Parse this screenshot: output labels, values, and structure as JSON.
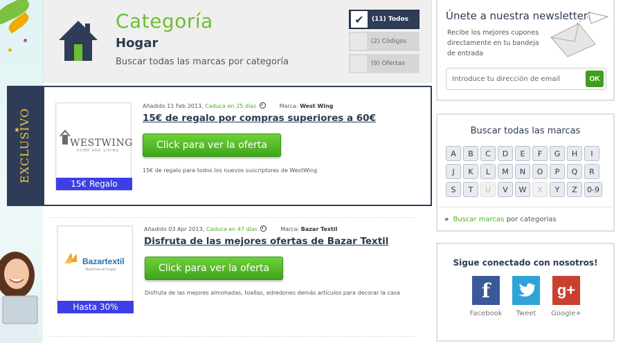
{
  "category": {
    "title": "Categoría",
    "name": "Hogar",
    "description": "Buscar todas las marcas por categoría"
  },
  "filters": [
    {
      "label": "(11) Todos",
      "selected": true
    },
    {
      "label": "(2) Códigos",
      "selected": false
    },
    {
      "label": "(9) Ofertas",
      "selected": false
    }
  ],
  "exclusive_label": "EXCLUSIVO",
  "offers": [
    {
      "added": "Añadido 11 Feb 2013,",
      "expires": "Caduca en 25 días",
      "brand_label": "Marca:",
      "brand": "West Wing",
      "title": "15€ de regalo por compras superiores a 60€",
      "cta": "Click para ver la oferta",
      "description": "15€ de regalo para todos los nuevos suscriptores de WestWing",
      "badge": "15€  Regalo",
      "logo_main": "WESTWING",
      "logo_sub": "HOME AND LIVING"
    },
    {
      "added": "Añadido 03 Apr 2013,",
      "expires": "Caduca en 47 días",
      "brand_label": "Marca:",
      "brand": "Bazar Textil",
      "title": "Disfruta de las mejores ofertas de Bazar Textil",
      "cta": "Click para ver la oferta",
      "description": "Disfruta de las mejores almohadas, toallas, edredones demás artículos para decorar la casa",
      "badge": "Hasta 30%",
      "logo_main": "Bazartextil",
      "logo_sub": "Vestimos el hogar"
    }
  ],
  "newsletter": {
    "title": "Únete a nuestra newsletter!",
    "text": "Recibe los mejores cupones directamente en tu bandeja de entrada",
    "placeholder": "Introduce tu dirección de email",
    "button": "OK"
  },
  "brands": {
    "title": "Buscar todas las marcas",
    "letters": [
      "A",
      "B",
      "C",
      "D",
      "E",
      "F",
      "G",
      "H",
      "I",
      "J",
      "K",
      "L",
      "M",
      "N",
      "O",
      "P",
      "Q",
      "R",
      "S",
      "T",
      "U",
      "V",
      "W",
      "X",
      "Y",
      "Z",
      "0-9"
    ],
    "disabled": [
      "U",
      "X"
    ],
    "link_prefix": "Buscar marcas",
    "link_suffix": " por categorias"
  },
  "social": {
    "title": "Sigue conectado con nosotros!",
    "networks": [
      {
        "name": "Facebook",
        "glyph": "f",
        "color": "#3b5998"
      },
      {
        "name": "Tweet",
        "glyph": "",
        "color": "#2ea3d8"
      },
      {
        "name": "Google+",
        "glyph": "g+",
        "color": "#c9402e"
      }
    ]
  },
  "colors": {
    "accent_green": "#6cbf2f",
    "navy": "#2e3c57",
    "badge_blue": "#3d3fe6",
    "ribbon_gold": "#f3c646"
  }
}
